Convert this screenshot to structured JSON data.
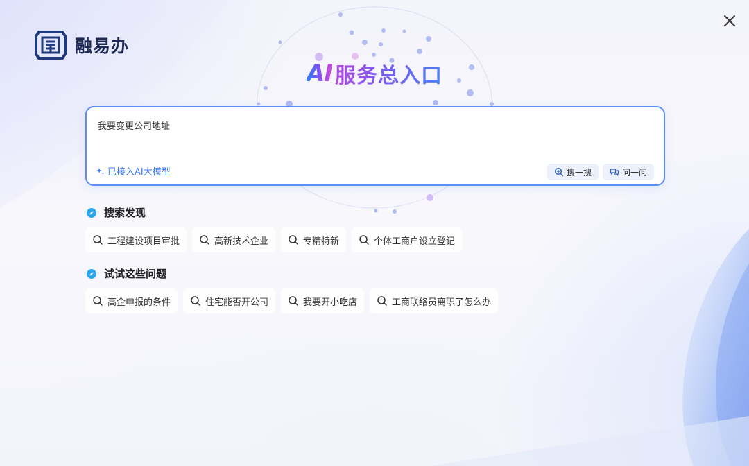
{
  "brand": {
    "name": "融易办",
    "logo_icon": "shield-seal-icon"
  },
  "window": {
    "close_icon": "close-icon"
  },
  "title": {
    "ai": "AI",
    "text": "服务总入口"
  },
  "search": {
    "value": "我要变更公司地址",
    "ai_badge": "已接入AI大模型",
    "search_button": "搜一搜",
    "ask_button": "问一问"
  },
  "discover": {
    "title": "搜索发现",
    "items": [
      "工程建设项目审批",
      "高新技术企业",
      "专精特新",
      "个体工商户设立登记"
    ]
  },
  "try_questions": {
    "title": "试试这些问题",
    "items": [
      "高企申报的条件",
      "住宅能否开公司",
      "我要开小吃店",
      "工商联络员离职了怎么办"
    ]
  },
  "colors": {
    "accent": "#3e7bf1",
    "border": "#5b8ff3",
    "section_icon": "#2aa7f0"
  }
}
